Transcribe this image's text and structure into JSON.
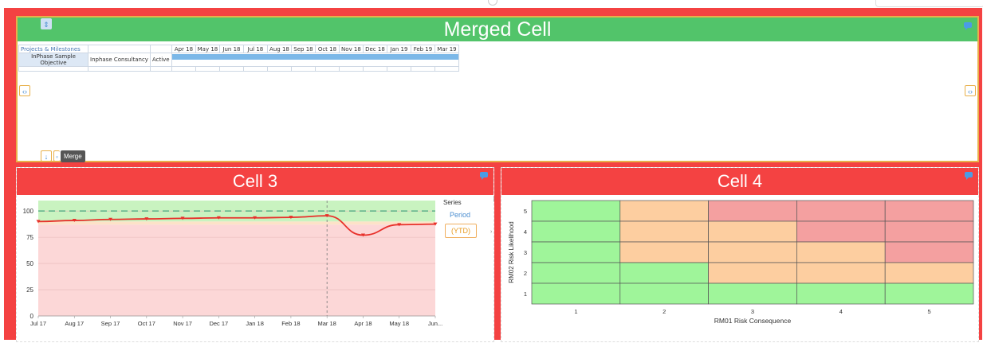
{
  "merged_cell": {
    "title": "Merged Cell",
    "merge_tooltip": "Merge",
    "gantt": {
      "header_label": "Projects & Milestones",
      "months": [
        "Apr 18",
        "May 18",
        "Jun 18",
        "Jul 18",
        "Aug 18",
        "Sep 18",
        "Oct 18",
        "Nov 18",
        "Dec 18",
        "Jan 19",
        "Feb 19",
        "Mar 19"
      ],
      "row": {
        "objective_line1": "InPhase Sample",
        "objective_line2": "Objective",
        "owner": "Inphase Consultancy",
        "status": "Active"
      }
    }
  },
  "cell3": {
    "title": "Cell 3",
    "legend": {
      "title": "Series",
      "period": "Period",
      "ytd": "(YTD)"
    }
  },
  "cell4": {
    "title": "Cell 4"
  },
  "chart_data": [
    {
      "type": "line",
      "title": "Cell 3",
      "categories": [
        "Jul 17",
        "Aug 17",
        "Sep 17",
        "Oct 17",
        "Nov 17",
        "Dec 17",
        "Jan 18",
        "Feb 18",
        "Mar 18",
        "Apr 18",
        "May 18",
        "Jun..."
      ],
      "series": [
        {
          "name": "Period",
          "values": [
            90,
            91,
            92,
            92.5,
            93,
            93.5,
            93.5,
            94,
            95.5,
            77,
            87,
            87.5
          ]
        }
      ],
      "target": 100,
      "ylim": [
        0,
        110
      ],
      "yticks": [
        0,
        25,
        50,
        75,
        100
      ],
      "bands": {
        "green_above": 90,
        "orange": [
          87,
          90
        ],
        "red_below": 87
      },
      "marker": "Mar 18",
      "legend_placement": "right",
      "colors": {
        "line": "#e8302a",
        "target": "#5fb08a",
        "green": "#c9f3c0",
        "red": "#fcd7d7"
      }
    },
    {
      "type": "heatmap",
      "title": "Cell 4",
      "xlabel": "RM01 Risk Consequence",
      "ylabel": "RM02 Risk Likelihood",
      "x": [
        1,
        2,
        3,
        4,
        5
      ],
      "y": [
        1,
        2,
        3,
        4,
        5
      ],
      "levels": [
        [
          "green",
          "orange",
          "red",
          "red",
          "red"
        ],
        [
          "green",
          "orange",
          "orange",
          "red",
          "red"
        ],
        [
          "green",
          "orange",
          "orange",
          "orange",
          "red"
        ],
        [
          "green",
          "green",
          "orange",
          "orange",
          "orange"
        ],
        [
          "green",
          "green",
          "green",
          "green",
          "green"
        ]
      ],
      "colors": {
        "green": "#9ff59a",
        "orange": "#fdcea0",
        "red": "#f4a0a0"
      }
    }
  ]
}
